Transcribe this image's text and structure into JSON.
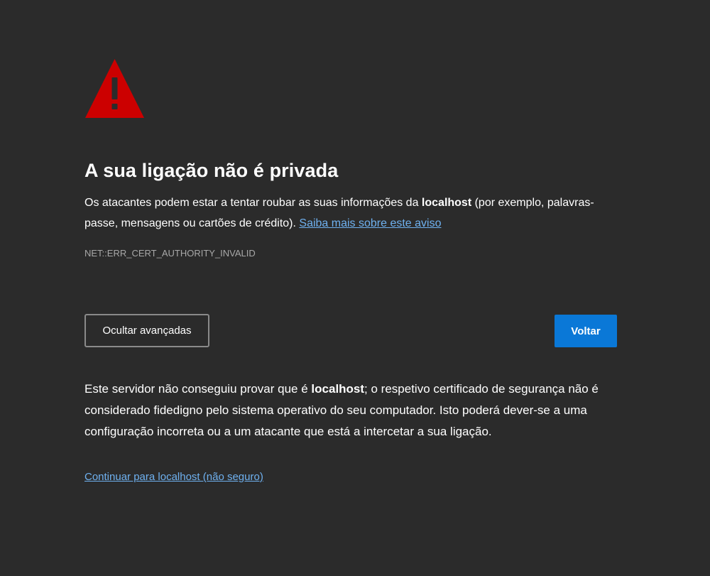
{
  "title": "A sua ligação não é privada",
  "intro": {
    "text_before": "Os atacantes podem estar a tentar roubar as suas informações da ",
    "host": "localhost",
    "text_after": " (por exemplo, palavras-passe, mensagens ou cartões de crédito). ",
    "learn_more_link": "Saiba mais sobre este aviso"
  },
  "error_code": "NET::ERR_CERT_AUTHORITY_INVALID",
  "buttons": {
    "advanced_label": "Ocultar avançadas",
    "back_label": "Voltar"
  },
  "details": {
    "text_before": "Este servidor não conseguiu provar que é ",
    "host": "localhost",
    "text_after": "; o respetivo certificado de segurança não é considerado fidedigno pelo sistema operativo do seu computador. Isto poderá dever-se a uma configuração incorreta ou a um atacante que está a intercetar a sua ligação."
  },
  "proceed_link": "Continuar para localhost (não seguro)",
  "colors": {
    "background": "#2b2b2b",
    "warning_red": "#cc0000",
    "link": "#6fb1f0",
    "primary_button": "#0a78d7"
  },
  "icons": {
    "warning": "warning-triangle-icon"
  }
}
